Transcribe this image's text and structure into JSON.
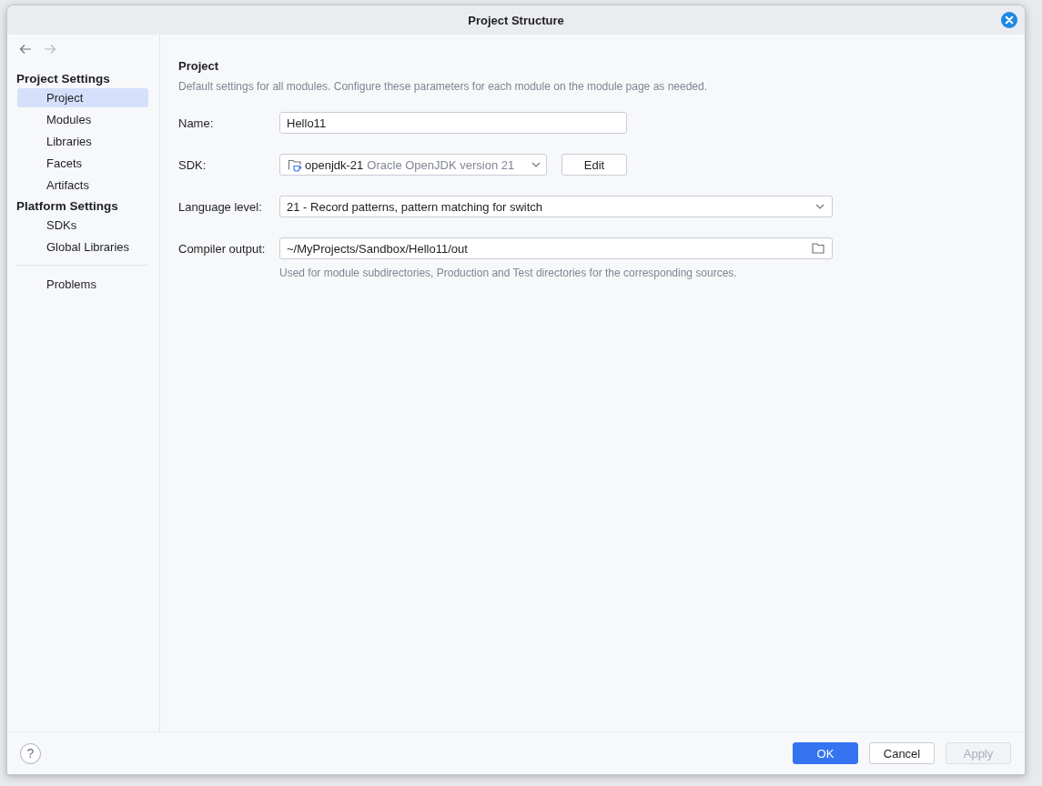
{
  "window": {
    "title": "Project Structure"
  },
  "sidebar": {
    "groups": [
      {
        "title": "Project Settings",
        "items": [
          {
            "label": "Project",
            "selected": true
          },
          {
            "label": "Modules",
            "selected": false
          },
          {
            "label": "Libraries",
            "selected": false
          },
          {
            "label": "Facets",
            "selected": false
          },
          {
            "label": "Artifacts",
            "selected": false
          }
        ]
      },
      {
        "title": "Platform Settings",
        "items": [
          {
            "label": "SDKs",
            "selected": false
          },
          {
            "label": "Global Libraries",
            "selected": false
          }
        ]
      }
    ],
    "extra_items": [
      {
        "label": "Problems",
        "selected": false
      }
    ]
  },
  "content": {
    "heading": "Project",
    "description": "Default settings for all modules. Configure these parameters for each module on the module page as needed.",
    "name_field": {
      "label": "Name:",
      "value": "Hello11"
    },
    "sdk": {
      "label": "SDK:",
      "name": "openjdk-21",
      "description": "Oracle OpenJDK version 21",
      "edit_button": "Edit"
    },
    "language_level": {
      "label": "Language level:",
      "value": "21 - Record patterns, pattern matching for switch"
    },
    "compiler_output": {
      "label": "Compiler output:",
      "value": "~/MyProjects/Sandbox/Hello11/out",
      "hint": "Used for module subdirectories, Production and Test directories for the corresponding sources."
    }
  },
  "footer": {
    "help": "?",
    "buttons": [
      {
        "label": "OK",
        "kind": "primary",
        "disabled": false
      },
      {
        "label": "Cancel",
        "kind": "secondary",
        "disabled": false
      },
      {
        "label": "Apply",
        "kind": "secondary",
        "disabled": true
      }
    ]
  }
}
